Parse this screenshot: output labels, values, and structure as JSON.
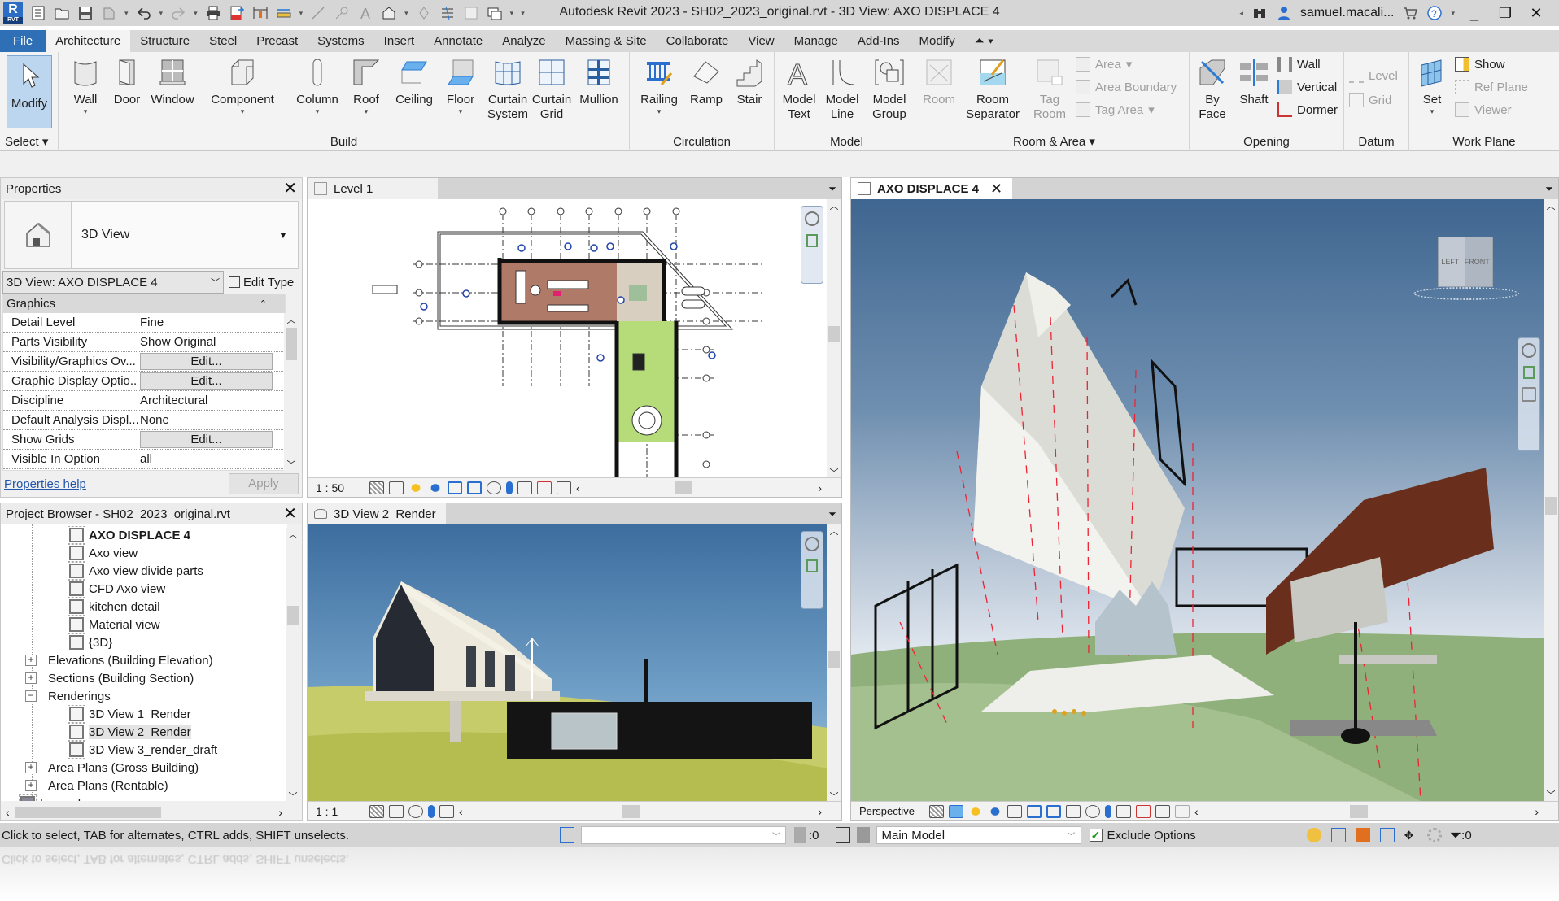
{
  "app": {
    "window_title": "Autodesk Revit 2023 - SH02_2023_original.rvt - 3D View: AXO DISPLACE 4",
    "logo_text": "R",
    "logo_sub": "RVT",
    "user": "samuel.macali...",
    "accent_color": "#2f6fb5"
  },
  "quick_access": [
    "open-icon",
    "save-icon",
    "sync-icon",
    "undo-icon",
    "redo-icon",
    "print-icon",
    "export-pdf-icon",
    "measure-icon",
    "dimension-icon",
    "tag-icon",
    "text-icon",
    "3d-view-icon",
    "section-icon",
    "thin-lines-icon",
    "close-hidden-icon",
    "switch-windows-icon"
  ],
  "ribbon_tabs": [
    "File",
    "Architecture",
    "Structure",
    "Steel",
    "Precast",
    "Systems",
    "Insert",
    "Annotate",
    "Analyze",
    "Massing & Site",
    "Collaborate",
    "View",
    "Manage",
    "Add-Ins",
    "Modify"
  ],
  "active_tab": "Architecture",
  "ribbon": {
    "select": {
      "tool": "Modify",
      "panel": "Select ▾"
    },
    "build": {
      "panel": "Build",
      "tools": [
        "Wall",
        "Door",
        "Window",
        "Component",
        "Column",
        "Roof",
        "Ceiling",
        "Floor",
        "Curtain System",
        "Curtain Grid",
        "Mullion"
      ]
    },
    "circulation": {
      "panel": "Circulation",
      "tools": [
        "Railing",
        "Ramp",
        "Stair"
      ]
    },
    "model": {
      "panel": "Model",
      "tools": [
        "Model Text",
        "Model Line",
        "Model Group"
      ]
    },
    "room_area": {
      "panel": "Room & Area ▾",
      "tools": [
        "Room",
        "Room Separator",
        "Tag Room"
      ],
      "small": [
        "Area",
        "Area Boundary",
        "Tag Area"
      ]
    },
    "opening": {
      "panel": "Opening",
      "tools": [
        "By Face",
        "Shaft"
      ],
      "small": [
        "Wall",
        "Vertical",
        "Dormer"
      ]
    },
    "datum": {
      "panel": "Datum",
      "small": [
        "Level",
        "Grid"
      ]
    },
    "work_plane": {
      "panel": "Work Plane",
      "tools": [
        "Set"
      ],
      "small": [
        "Show",
        "Ref  Plane",
        "Viewer"
      ]
    }
  },
  "properties": {
    "title": "Properties",
    "type_name": "3D View",
    "instance": "3D View: AXO DISPLACE 4",
    "edit_type": "Edit Type",
    "group": "Graphics",
    "rows": [
      {
        "name": "Detail Level",
        "value": "Fine",
        "button": false
      },
      {
        "name": "Parts Visibility",
        "value": "Show Original",
        "button": false
      },
      {
        "name": "Visibility/Graphics Ov...",
        "value": "Edit...",
        "button": true
      },
      {
        "name": "Graphic Display Optio...",
        "value": "Edit...",
        "button": true
      },
      {
        "name": "Discipline",
        "value": "Architectural",
        "button": false
      },
      {
        "name": "Default Analysis Displ...",
        "value": "None",
        "button": false
      },
      {
        "name": "Show Grids",
        "value": "Edit...",
        "button": true
      },
      {
        "name": "Visible In Option",
        "value": "all",
        "button": false
      }
    ],
    "help_link": "Properties help",
    "apply": "Apply"
  },
  "browser": {
    "title": "Project Browser - SH02_2023_original.rvt",
    "items": [
      {
        "label": "AXO DISPLACE 4",
        "level": 2,
        "type": "view",
        "bold": true
      },
      {
        "label": "Axo view",
        "level": 2,
        "type": "view"
      },
      {
        "label": "Axo view divide parts",
        "level": 2,
        "type": "view"
      },
      {
        "label": "CFD Axo view",
        "level": 2,
        "type": "view"
      },
      {
        "label": "kitchen detail",
        "level": 2,
        "type": "view"
      },
      {
        "label": "Material view",
        "level": 2,
        "type": "view"
      },
      {
        "label": "{3D}",
        "level": 2,
        "type": "view"
      },
      {
        "label": "Elevations (Building Elevation)",
        "level": 1,
        "type": "plus"
      },
      {
        "label": "Sections (Building Section)",
        "level": 1,
        "type": "plus"
      },
      {
        "label": "Renderings",
        "level": 1,
        "type": "minus"
      },
      {
        "label": "3D View 1_Render",
        "level": 2,
        "type": "view"
      },
      {
        "label": "3D View 2_Render",
        "level": 2,
        "type": "view",
        "selected": true
      },
      {
        "label": "3D View 3_render_draft",
        "level": 2,
        "type": "view"
      },
      {
        "label": "Area Plans (Gross Building)",
        "level": 1,
        "type": "plus"
      },
      {
        "label": "Area Plans (Rentable)",
        "level": 1,
        "type": "plus"
      },
      {
        "label": "Legends",
        "level": 0,
        "type": "legend"
      }
    ]
  },
  "views": {
    "level1": {
      "tab": "Level 1",
      "scale": "1 : 50"
    },
    "render2": {
      "tab": "3D View 2_Render",
      "scale": "1 : 1"
    },
    "axo": {
      "tab": "AXO DISPLACE 4",
      "projection": "Perspective",
      "viewcube_left": "LEFT",
      "viewcube_front": "FRONT"
    }
  },
  "status": {
    "text": "Click to select, TAB for alternates, CTRL adds, SHIFT unselects.",
    "selection_count": ":0",
    "design_option": "Main Model",
    "exclude_options": "Exclude Options",
    "exclude_checked": true,
    "filter_count": ":0"
  }
}
